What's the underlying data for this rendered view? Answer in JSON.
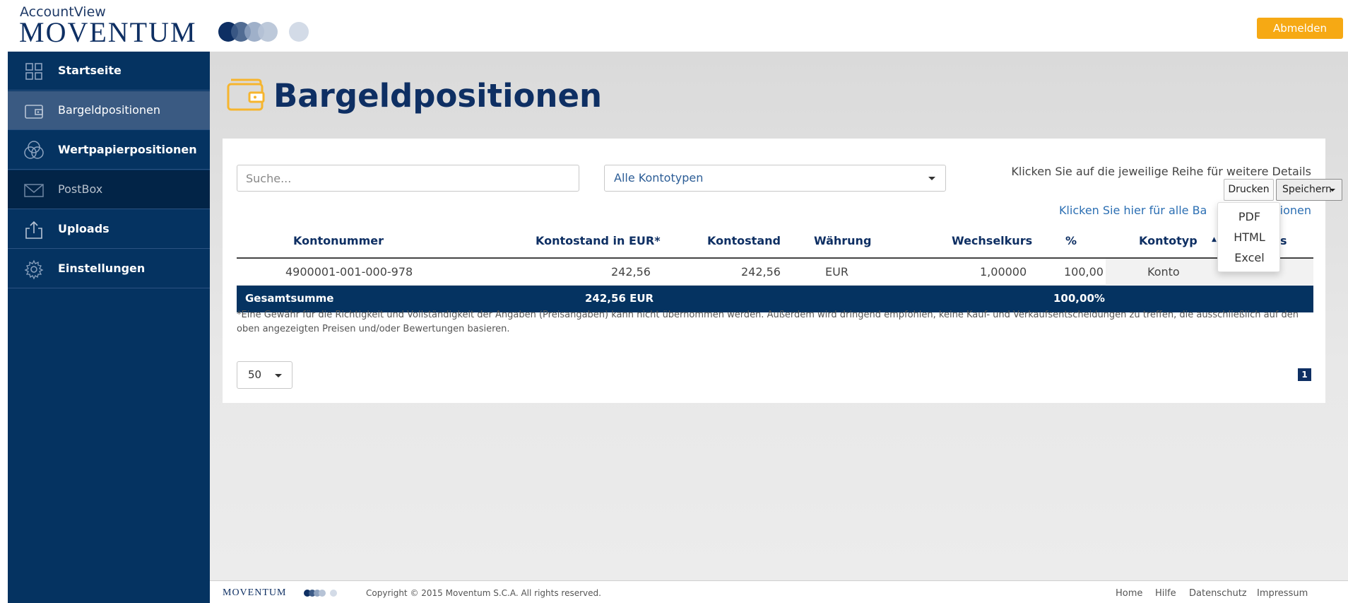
{
  "header": {
    "brand_sub": "AccountView",
    "brand": "MOVENTUM",
    "logout_label": "Abmelden",
    "accent_color": "#f6a914",
    "brand_color": "#0e2f63"
  },
  "sidebar": {
    "items": [
      {
        "label": "Startseite",
        "icon": "dashboard-grid-icon",
        "state": "normal"
      },
      {
        "label": "Bargeldpositionen",
        "icon": "wallet-icon",
        "state": "active"
      },
      {
        "label": "Wertpapierpositionen",
        "icon": "overlapping-circles-icon",
        "state": "normal"
      },
      {
        "label": "PostBox",
        "icon": "envelope-icon",
        "state": "dark"
      },
      {
        "label": "Uploads",
        "icon": "upload-icon",
        "state": "normal"
      },
      {
        "label": "Einstellungen",
        "icon": "gear-icon",
        "state": "normal"
      }
    ]
  },
  "main": {
    "title": "Bargeldpositionen",
    "title_icon": "wallet-icon",
    "search_placeholder": "Suche...",
    "account_type_select": "Alle Kontotypen",
    "hint": "Klicken Sie auf die jeweilige Reihe für weitere Details",
    "print_label": "Drucken",
    "save_label": "Speichern",
    "all_positions_link": "Klicken Sie hier für alle Ba",
    "all_positions_link_tail": "tionen",
    "save_menu": [
      "PDF",
      "HTML",
      "Excel"
    ],
    "table": {
      "headers": [
        "Kontonummer",
        "Kontostand in EUR*",
        "Kontostand",
        "Währung",
        "Wechselkurs",
        "%",
        "Kontotyp",
        "s"
      ],
      "rows": [
        [
          "4900001-001-000-978",
          "242,56",
          "242,56",
          "EUR",
          "1,00000",
          "100,00",
          "Konto"
        ]
      ],
      "footer": {
        "label": "Gesamtsumme",
        "total_eur": "242,56 EUR",
        "total_pct": "100,00%"
      }
    },
    "disclaimer": "*Eine Gewähr für die Richtigkeit und Vollständigkeit der Angaben (Preisangaben) kann nicht übernommen werden. Außerdem wird dringend empfohlen, keine Kauf- und Verkaufsentscheidungen zu treffen, die ausschließlich auf den oben angezeigten Preisen und/oder Bewertungen basieren.",
    "page_size": "50",
    "current_page": "1"
  },
  "footer": {
    "brand": "MOVENTUM",
    "copyright": "Copyright © 2015 Moventum S.C.A. All rights reserved.",
    "links": [
      "Home",
      "Hilfe",
      "Datenschutz",
      "Impressum"
    ]
  }
}
